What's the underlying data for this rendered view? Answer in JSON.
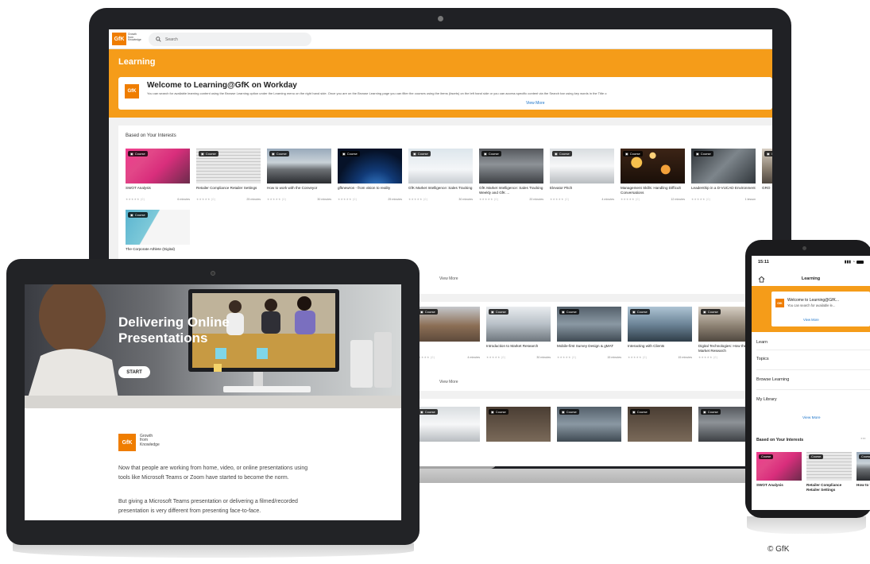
{
  "laptop": {
    "logo": "GfK",
    "logo_tagline": [
      "Growth",
      "from",
      "Knowledge"
    ],
    "search_placeholder": "Search",
    "section_title": "Learning",
    "welcome": {
      "title": "Welcome to Learning@GfK on Workday",
      "body": "You can search for available learning content using the Browse Learning option under the Learning menu on the right hand side. Once you are on the Browse Learning page you can filter the courses using the items (facets) on the left hand side or you can access specific content via the Search bar using key words in the Title o",
      "view_more": "View More"
    },
    "interests": {
      "title": "Based on Your Interests",
      "badge": "Course",
      "tiles": [
        {
          "title": "SWOT Analysis",
          "rating": "(0)",
          "duration": "6 minutes",
          "img": "t-swot"
        },
        {
          "title": "Retailer Compliance Retailer Settings",
          "rating": "(0)",
          "duration": "25 minutes",
          "img": "t-doc"
        },
        {
          "title": "How to work with the Conveyor",
          "rating": "(0)",
          "duration": "30 minutes",
          "img": "t-tunnel"
        },
        {
          "title": "gfknewron - from vision to reality",
          "rating": "(0)",
          "duration": "25 minutes",
          "img": "t-earth"
        },
        {
          "title": "GfK Market Intelligence: Sales Tracking",
          "rating": "(0)",
          "duration": "30 minutes",
          "img": "t-people"
        },
        {
          "title": "GfK Market Intelligence: Sales Tracking Weekly and GfK ...",
          "rating": "(0)",
          "duration": "20 minutes",
          "img": "t-street"
        },
        {
          "title": "Elevator Pitch",
          "rating": "(0)",
          "duration": "4 minutes",
          "img": "t-office"
        },
        {
          "title": "Management Skills: Handling Difficult Conversations",
          "rating": "(0)",
          "duration": "12 minutes",
          "img": "t-bokeh"
        },
        {
          "title": "Leadership in a D-VUCAD Environment",
          "rating": "(0)",
          "duration": "1 lesson",
          "img": "t-stairs"
        },
        {
          "title": "GRO",
          "rating": "",
          "duration": "",
          "img": "t-city"
        },
        {
          "title": "The Corporate Athlete (Digital)",
          "rating": "",
          "duration": "",
          "img": "t-map"
        }
      ],
      "view_more": "View More"
    },
    "row2": {
      "tiles": [
        {
          "title": "",
          "rating": "(0)",
          "duration": "4 minutes",
          "img": "t-meet"
        },
        {
          "title": "Introduction to Market Research",
          "rating": "(0)",
          "duration": "30 minutes",
          "img": "t-corr"
        },
        {
          "title": "Mobile-first Survey Design & gMAT",
          "rating": "(0)",
          "duration": "15 minutes",
          "img": "t-crowd"
        },
        {
          "title": "Interacting with Clients",
          "rating": "(0)",
          "duration": "15 minutes",
          "img": "t-man"
        },
        {
          "title": "Digital Technologies: How they affect Market Research",
          "rating": "(0)",
          "duration": "15 mi",
          "img": "t-city"
        }
      ],
      "view_more": "View More"
    },
    "row3": {
      "tiles": [
        {
          "img": "t-office"
        },
        {
          "img": "t-dark"
        },
        {
          "img": "t-crowd"
        },
        {
          "img": "t-dark"
        },
        {
          "img": "t-street"
        }
      ]
    }
  },
  "tablet": {
    "hero_title": "Delivering Online Presentations",
    "start_label": "START",
    "logo": "GfK",
    "logo_tagline": [
      "Growth",
      "from",
      "Knowledge"
    ],
    "paragraph1": "Now that people are working from home, video, or online presentations using tools like Microsoft Teams or Zoom have started to become the norm.",
    "paragraph2": "But giving a Microsoft Teams presentation or delivering a filmed/recorded presentation is very different from presenting face-to-face."
  },
  "phone": {
    "time": "15:11",
    "header_title": "Learning",
    "logo": "GfK",
    "welcome_title": "Welcome to Learning@GfK...",
    "welcome_body": "You can search for available le...",
    "view_more": "View More",
    "menu": [
      "Learn",
      "Topics",
      "Browse Learning",
      "My Library"
    ],
    "menu_view_more": "View More",
    "interests_title": "Based on Your Interests",
    "badge": "Course",
    "tiles": [
      {
        "title": "SWOT Analysis",
        "img": "t-swot"
      },
      {
        "title": "Retailer Compliance Retailer Settings",
        "img": "t-doc"
      },
      {
        "title": "How to the Cor",
        "img": "t-tunnel"
      }
    ]
  },
  "copyright": "© GfK",
  "colors": {
    "brand_orange": "#ef7d00",
    "band_orange": "#f59c19",
    "link_blue": "#1a73c9"
  }
}
